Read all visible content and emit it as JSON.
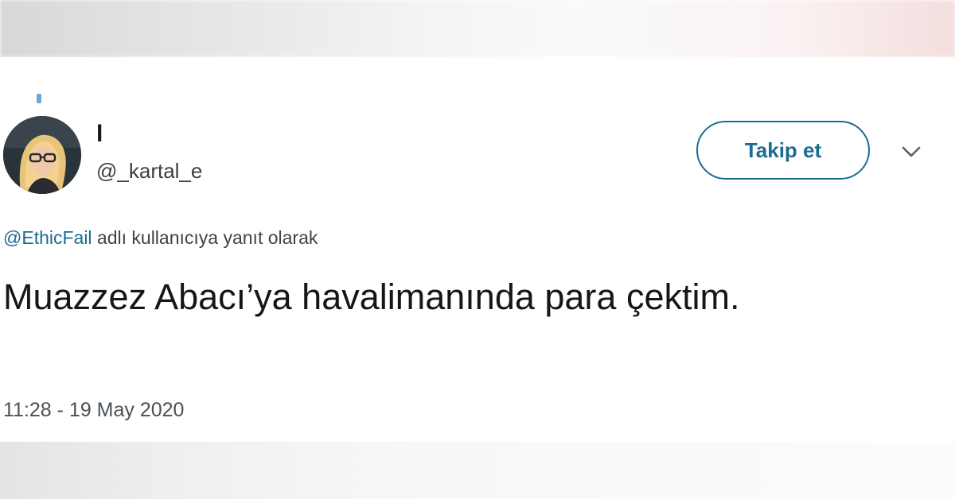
{
  "tweet": {
    "display_name": "l",
    "handle": "@_kartal_e",
    "follow_label": "Takip et",
    "reply_to_user": "@EthicFail",
    "reply_suffix": " adlı kullanıcıya yanıt olarak",
    "text": "Muazzez Abacı’ya havalimanında para çektim.",
    "timestamp": "11:28 - 19 May 2020"
  },
  "icons": {
    "menu": "chevron-down-icon",
    "avatar": "profile-photo"
  },
  "colors": {
    "link": "#1b6c92",
    "text": "#14171a",
    "secondary": "#3f444a"
  }
}
